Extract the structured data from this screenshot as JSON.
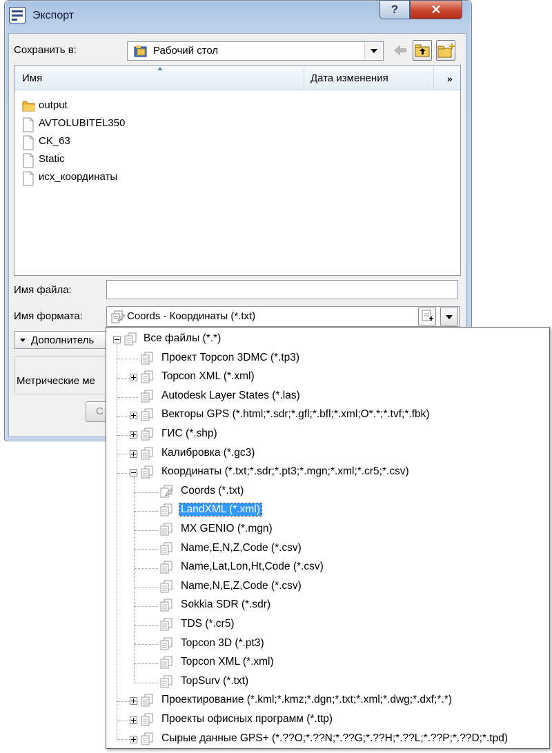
{
  "window": {
    "title": "Экспорт",
    "help_label": "?",
    "close_label": "✕"
  },
  "toolbar": {
    "save_in_label": "Сохранить в:",
    "location": "Рабочий стол"
  },
  "file_list": {
    "col_name": "Имя",
    "col_date": "Дата изменения",
    "col_more": "»",
    "items": [
      {
        "name": "output",
        "icon": "folder-icon"
      },
      {
        "name": "AVTOLUBITEL350",
        "icon": "file-icon"
      },
      {
        "name": "CK_63",
        "icon": "file-icon"
      },
      {
        "name": "Static",
        "icon": "file-icon"
      },
      {
        "name": "исх_координаты",
        "icon": "file-icon"
      }
    ]
  },
  "form": {
    "file_name_label": "Имя файла:",
    "file_name_value": "",
    "format_label": "Имя формата:",
    "format_value": "Coords - Координаты (*.txt)",
    "advanced_label": "Дополнитель",
    "metric_label": "Метрические ме",
    "cancel_label": "С"
  },
  "format_tree": [
    {
      "label": "Все файлы (*.*)",
      "expander": "minus",
      "level": 0
    },
    {
      "label": "Проект Topcon 3DMC (*.tp3)",
      "expander": "none",
      "level": 1
    },
    {
      "label": "Topcon XML (*.xml)",
      "expander": "plus",
      "level": 1
    },
    {
      "label": "Autodesk Layer States (*.las)",
      "expander": "none",
      "level": 1
    },
    {
      "label": "Векторы GPS (*.html;*.sdr;*.gfl;*.bfl;*.xml;O*.*;*.tvf;*.fbk)",
      "expander": "plus",
      "level": 1
    },
    {
      "label": "ГИС (*.shp)",
      "expander": "plus",
      "level": 1
    },
    {
      "label": "Калибровка (*.gc3)",
      "expander": "plus",
      "level": 1
    },
    {
      "label": "Координаты (*.txt;*.sdr;*.pt3;*.mgn;*.xml;*.cr5;*.csv)",
      "expander": "minus",
      "level": 1
    },
    {
      "label": "Coords (*.txt)",
      "expander": "none",
      "level": 2
    },
    {
      "label": "LandXML (*.xml)",
      "expander": "none",
      "level": 2,
      "selected": true
    },
    {
      "label": "MX GENIO (*.mgn)",
      "expander": "none",
      "level": 2
    },
    {
      "label": "Name,E,N,Z,Code (*.csv)",
      "expander": "none",
      "level": 2
    },
    {
      "label": "Name,Lat,Lon,Ht,Code (*.csv)",
      "expander": "none",
      "level": 2
    },
    {
      "label": "Name,N,E,Z,Code (*.csv)",
      "expander": "none",
      "level": 2
    },
    {
      "label": "Sokkia SDR (*.sdr)",
      "expander": "none",
      "level": 2
    },
    {
      "label": "TDS (*.cr5)",
      "expander": "none",
      "level": 2
    },
    {
      "label": "Topcon 3D (*.pt3)",
      "expander": "none",
      "level": 2
    },
    {
      "label": "Topcon XML (*.xml)",
      "expander": "none",
      "level": 2
    },
    {
      "label": "TopSurv (*.txt)",
      "expander": "none",
      "level": 2
    },
    {
      "label": "Проектирование (*.kml;*.kmz;*.dgn;*.txt;*.xml;*.dwg;*.dxf;*.*)",
      "expander": "plus",
      "level": 1
    },
    {
      "label": "Проекты офисных программ (*.ttp)",
      "expander": "plus",
      "level": 1
    },
    {
      "label": "Сырые данные GPS+ (*.??O;*.??N;*.??G;*.??H;*.??L;*.??P;*.??D;*.tpd)",
      "expander": "plus",
      "level": 1
    }
  ]
}
